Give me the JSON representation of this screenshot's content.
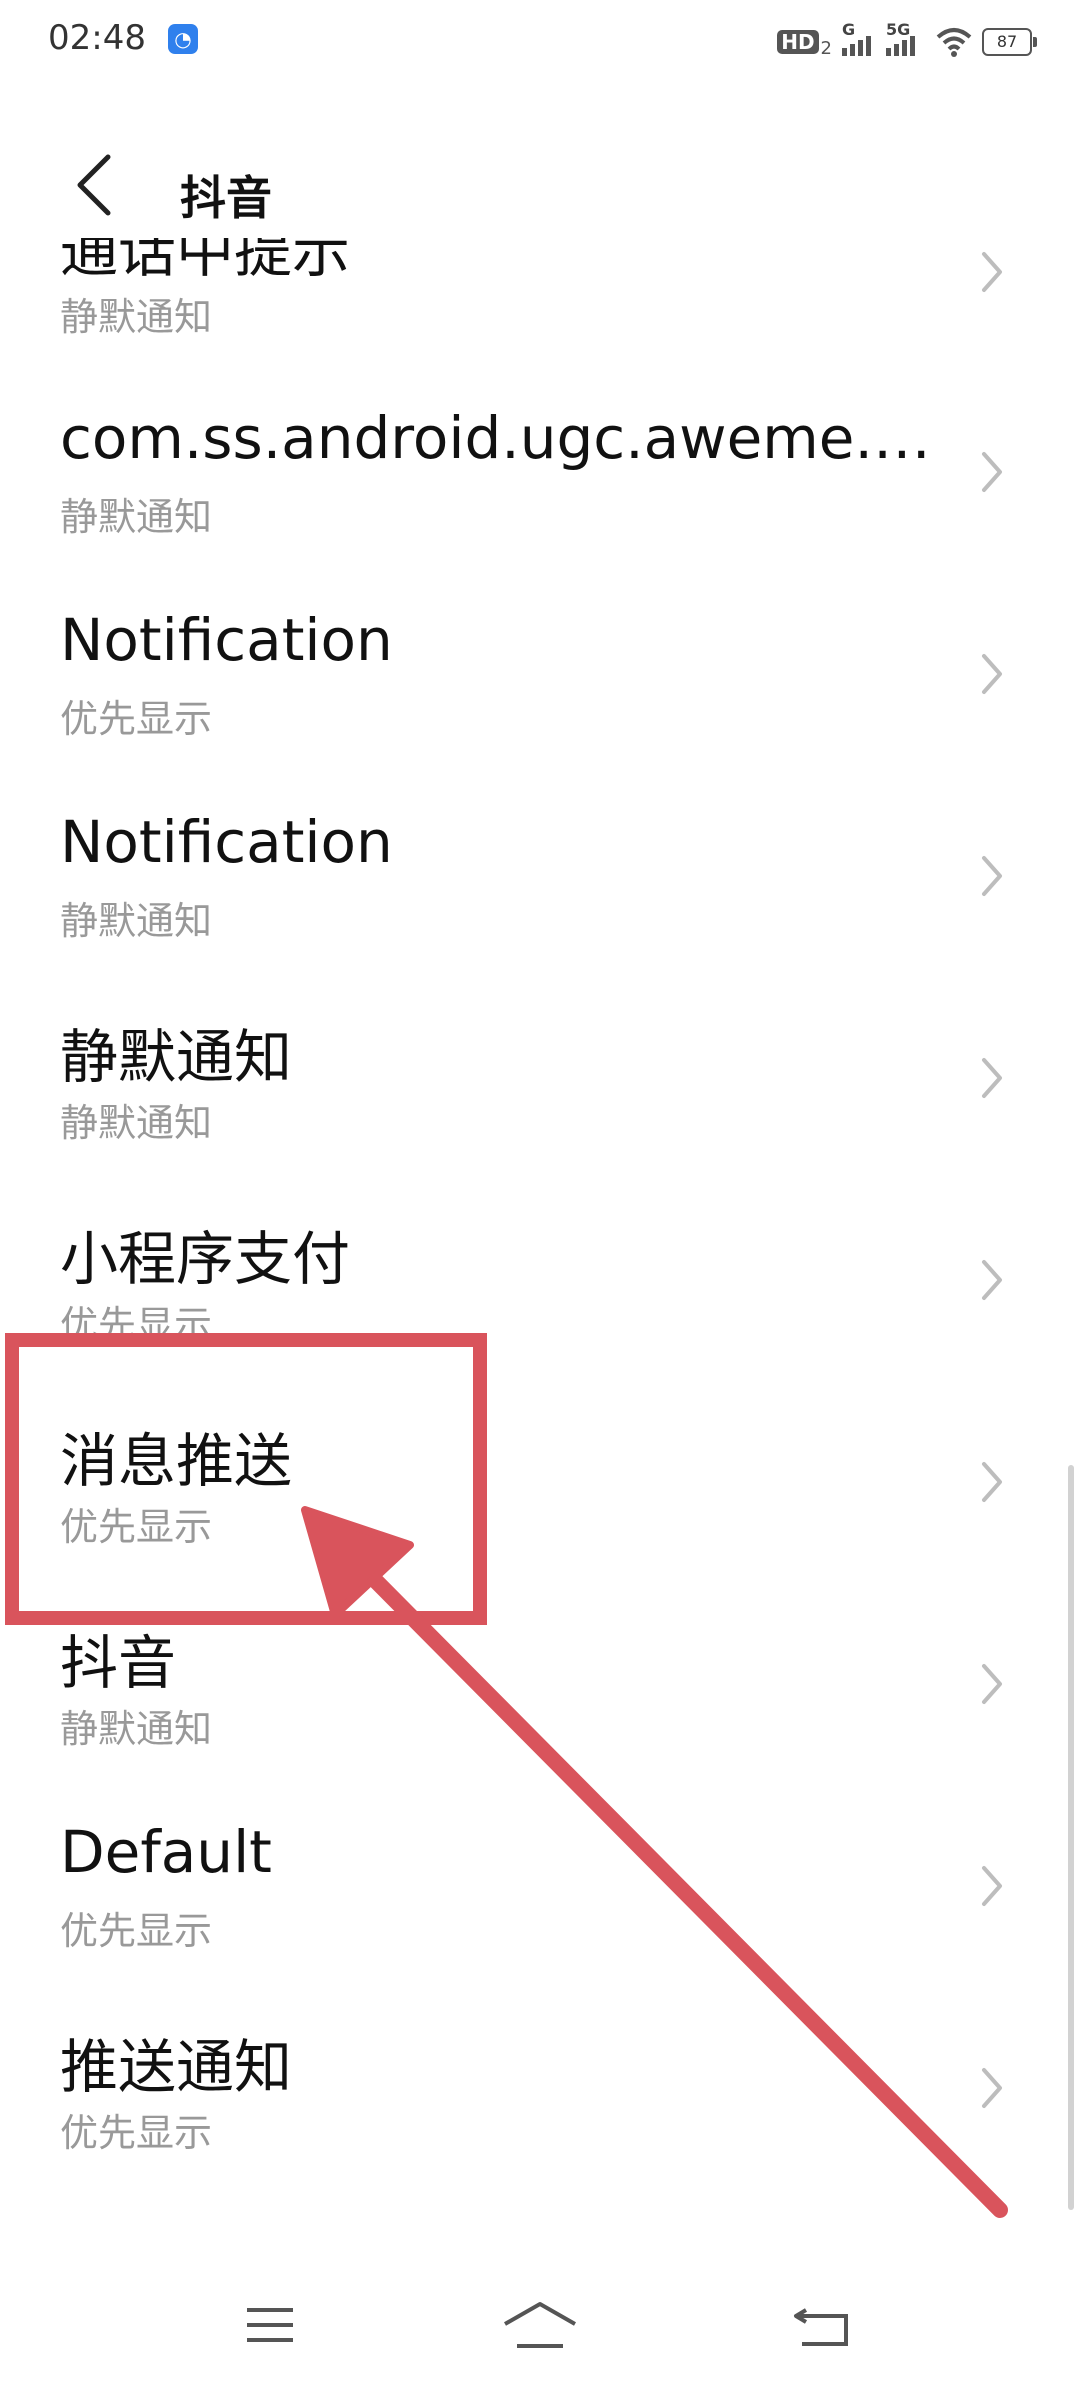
{
  "status_bar": {
    "time": "02:48",
    "app_icon": "app-notification-icon",
    "hd_label": "HD",
    "hd_sub": "2",
    "sim1_label": "G",
    "sim2_label": "5G",
    "battery": "87"
  },
  "header": {
    "back_icon": "chevron-left-icon",
    "title": "抖音"
  },
  "channels": [
    {
      "title": "通话中提示",
      "subtitle": "静默通知"
    },
    {
      "title": "com.ss.android.ugc.aweme.…",
      "subtitle": "静默通知"
    },
    {
      "title": "Notification",
      "subtitle": "优先显示"
    },
    {
      "title": "Notification",
      "subtitle": "静默通知"
    },
    {
      "title": "静默通知",
      "subtitle": "静默通知"
    },
    {
      "title": "小程序支付",
      "subtitle": "优先显示"
    },
    {
      "title": "消息推送",
      "subtitle": "优先显示"
    },
    {
      "title": "抖音",
      "subtitle": "静默通知"
    },
    {
      "title": "Default",
      "subtitle": "优先显示"
    },
    {
      "title": "推送通知",
      "subtitle": "优先显示"
    }
  ],
  "annotation": {
    "color": "#d9545c",
    "highlighted_item": "消息推送"
  },
  "nav_bar": {
    "menu_icon": "menu-icon",
    "home_icon": "home-icon",
    "back_icon": "back-return-icon"
  }
}
